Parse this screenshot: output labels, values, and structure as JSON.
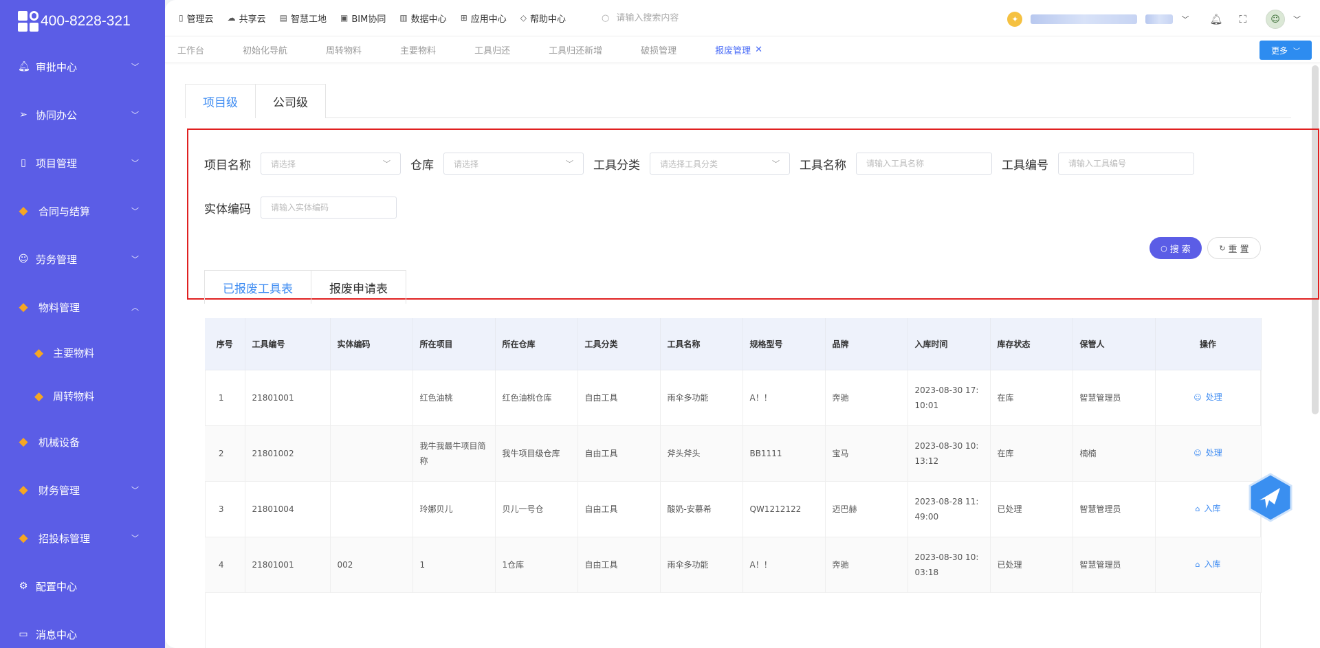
{
  "brand": {
    "phone": "400-8228-321"
  },
  "sidebar": {
    "items": [
      {
        "label": "审批中心",
        "icon": "bell-icon"
      },
      {
        "label": "协同办公",
        "icon": "send-icon"
      },
      {
        "label": "项目管理",
        "icon": "book-icon"
      },
      {
        "label": "合同与结算",
        "icon": "gem-icon"
      },
      {
        "label": "劳务管理",
        "icon": "user-icon"
      },
      {
        "label": "物料管理",
        "icon": "gem-icon"
      },
      {
        "label": "机械设备",
        "icon": "gem-icon"
      },
      {
        "label": "财务管理",
        "icon": "gem-icon"
      },
      {
        "label": "招投标管理",
        "icon": "gem-icon"
      },
      {
        "label": "配置中心",
        "icon": "gear-icon"
      },
      {
        "label": "消息中心",
        "icon": "message-icon"
      }
    ],
    "sub_items": [
      {
        "label": "主要物料"
      },
      {
        "label": "周转物料"
      }
    ]
  },
  "topnav": {
    "items": [
      "管理云",
      "共享云",
      "智慧工地",
      "BIM协同",
      "数据中心",
      "应用中心",
      "帮助中心"
    ],
    "search_placeholder": "请输入搜索内容"
  },
  "tabs": {
    "items": [
      "工作台",
      "初始化导航",
      "周转物料",
      "主要物料",
      "工具归还",
      "工具归还新增",
      "破损管理",
      "报废管理"
    ],
    "more_label": "更多"
  },
  "level_tabs": [
    "项目级",
    "公司级"
  ],
  "filters": {
    "project_name": {
      "label": "项目名称",
      "placeholder": "请选择"
    },
    "warehouse": {
      "label": "仓库",
      "placeholder": "请选择"
    },
    "tool_category": {
      "label": "工具分类",
      "placeholder": "请选择工具分类"
    },
    "tool_name": {
      "label": "工具名称",
      "placeholder": "请输入工具名称"
    },
    "tool_code": {
      "label": "工具编号",
      "placeholder": "请输入工具编号"
    },
    "entity_code": {
      "label": "实体编码",
      "placeholder": "请输入实体编码"
    },
    "search_label": "搜 索",
    "reset_label": "重 置"
  },
  "sub_tabs": [
    "已报废工具表",
    "报废申请表"
  ],
  "table": {
    "headers": [
      "序号",
      "工具编号",
      "实体编码",
      "所在项目",
      "所在仓库",
      "工具分类",
      "工具名称",
      "规格型号",
      "品牌",
      "入库时间",
      "库存状态",
      "保管人",
      "操作"
    ],
    "rows": [
      [
        "1",
        "21801001",
        "",
        "红色油桃",
        "红色油桃仓库",
        "自由工具",
        "雨伞多功能",
        "A！！",
        "奔驰",
        "2023-08-30 17:10:01",
        "在库",
        "智慧管理员",
        "处理"
      ],
      [
        "2",
        "21801002",
        "",
        "我牛我最牛项目简称",
        "我牛项目级仓库",
        "自由工具",
        "斧头斧头",
        "BB1111",
        "宝马",
        "2023-08-30 10:13:12",
        "在库",
        "楠楠",
        "处理"
      ],
      [
        "3",
        "21801004",
        "",
        "玲娜贝儿",
        "贝儿一号仓",
        "自由工具",
        "酸奶-安慕希",
        "QW1212122",
        "迈巴赫",
        "2023-08-28 11:49:00",
        "已处理",
        "智慧管理员",
        "入库"
      ],
      [
        "4",
        "21801001",
        "002",
        "1",
        "1仓库",
        "自由工具",
        "雨伞多功能",
        "A！！",
        "奔驰",
        "2023-08-30 10:03:18",
        "已处理",
        "智慧管理员",
        "入库"
      ]
    ]
  },
  "colors": {
    "sidebar": "#5b5de6",
    "accent": "#3d8bf2",
    "highlight": "#e02020"
  }
}
